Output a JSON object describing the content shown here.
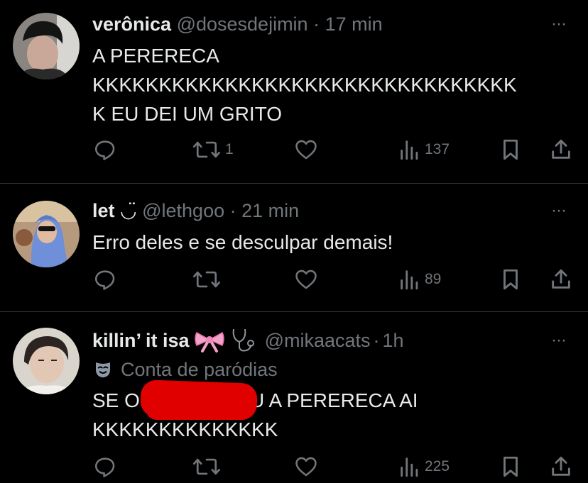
{
  "posts": [
    {
      "name": "verônica",
      "handle": "@dosesdejimin",
      "time": "17 min",
      "text_lines": [
        "A PERERECA",
        "KKKKKKKKKKKKKKKKKKKKKKKKKKKKKKKK",
        "K EU DEI UM GRITO"
      ],
      "replies": "",
      "reposts": "1",
      "likes": "",
      "views": "137"
    },
    {
      "name": "let",
      "name_emoji": "◡̈",
      "handle": "@lethgoo",
      "time": "21 min",
      "text_lines": [
        "Erro deles e se desculpar demais!"
      ],
      "replies": "",
      "reposts": "",
      "likes": "",
      "views": "89"
    },
    {
      "name": "killin’ it isa",
      "handle": "@mikaacats",
      "time": "1h",
      "label": "Conta de paródias",
      "text_prefix": "SE O",
      "text_suffix": "U A PERERECA AI",
      "text_line2": "KKKKKKKKKKKKKK",
      "replies": "",
      "reposts": "",
      "likes": "",
      "views": "225"
    }
  ],
  "ui": {
    "more_glyph": "···",
    "separator": "·"
  },
  "colors": {
    "background": "#000000",
    "text": "#e7e9ea",
    "muted": "#71767b",
    "divider": "#2f3336",
    "redaction": "#e10000"
  },
  "icons": [
    "reply-icon",
    "repost-icon",
    "like-icon",
    "views-icon",
    "bookmark-icon",
    "share-icon",
    "more-icon",
    "bow-emoji",
    "stethoscope-emoji",
    "mask-icon"
  ]
}
